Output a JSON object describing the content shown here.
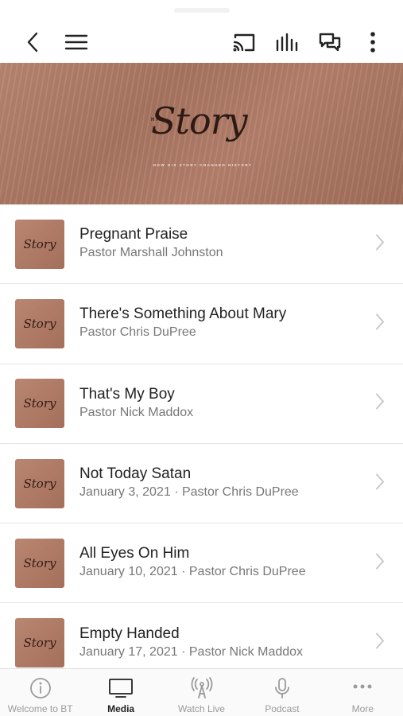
{
  "toolbar": {
    "icons": [
      "back-icon",
      "menu-icon",
      "cast-icon",
      "audio-bars-icon",
      "chat-icon",
      "more-vertical-icon"
    ]
  },
  "banner": {
    "his": "HIS",
    "story": "Story",
    "tagline": "HOW HIS STORY CHANGED HISTORY"
  },
  "thumb_text": "Story",
  "items": [
    {
      "title": "Pregnant Praise",
      "subtitle": "Pastor Marshall Johnston"
    },
    {
      "title": "There's Something About Mary",
      "subtitle": "Pastor Chris DuPree"
    },
    {
      "title": "That's My Boy",
      "subtitle": "Pastor Nick Maddox"
    },
    {
      "title": "Not Today Satan",
      "subtitle": "January 3, 2021 · Pastor Chris DuPree"
    },
    {
      "title": "All Eyes On Him",
      "subtitle": "January 10, 2021 · Pastor Chris DuPree"
    },
    {
      "title": "Empty Handed",
      "subtitle": "January 17, 2021 · Pastor Nick Maddox"
    }
  ],
  "tabs": [
    {
      "label": "Welcome to BT",
      "icon": "info-icon",
      "active": false
    },
    {
      "label": "Media",
      "icon": "tv-icon",
      "active": true
    },
    {
      "label": "Watch Live",
      "icon": "broadcast-icon",
      "active": false
    },
    {
      "label": "Podcast",
      "icon": "microphone-icon",
      "active": false
    },
    {
      "label": "More",
      "icon": "more-horizontal-icon",
      "active": false
    }
  ],
  "colors": {
    "banner": "#b07c68",
    "active_tab": "#222222",
    "inactive_tab": "#9a9a9a"
  }
}
